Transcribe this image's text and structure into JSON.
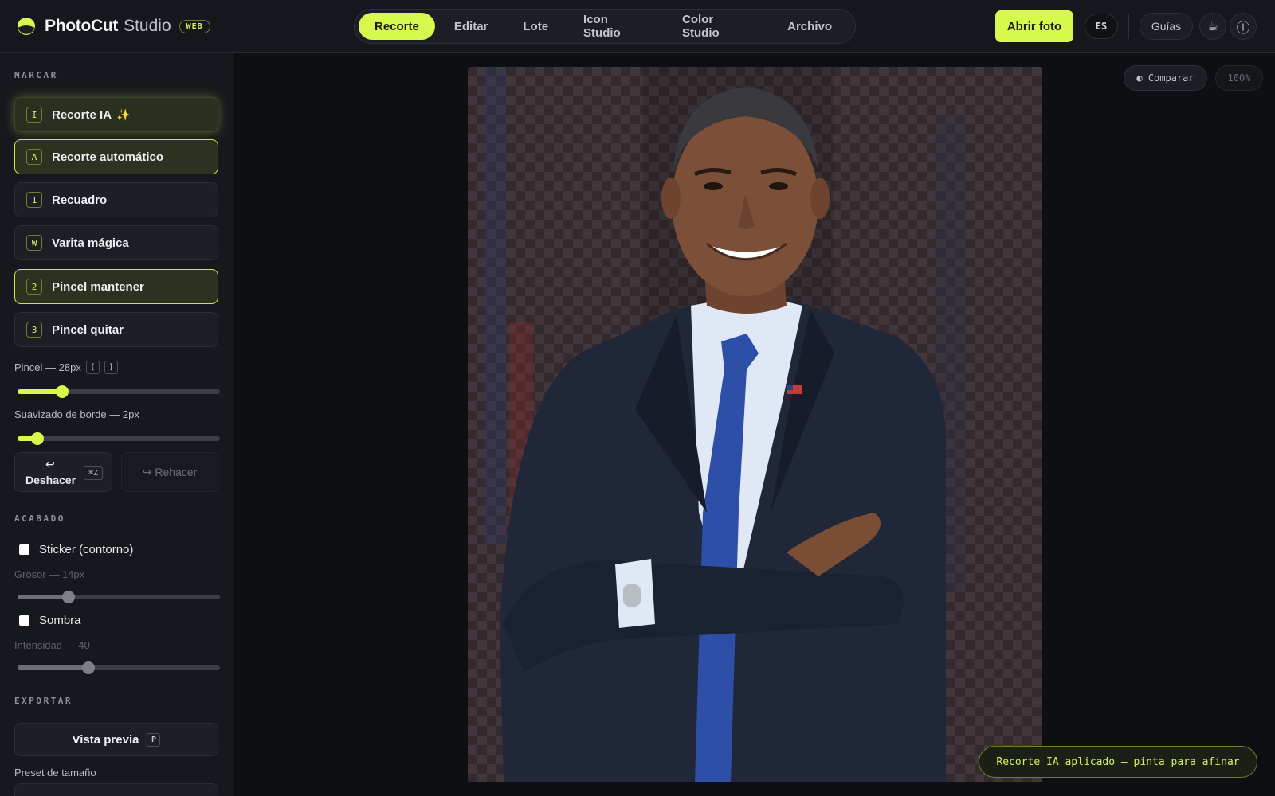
{
  "app": {
    "brand_name": "PhotoCut",
    "brand_sub": "Studio",
    "brand_badge": "WEB"
  },
  "tabs": [
    {
      "label": "Recorte",
      "active": true
    },
    {
      "label": "Editar",
      "active": false
    },
    {
      "label": "Lote",
      "active": false
    },
    {
      "label": "Icon Studio",
      "active": false
    },
    {
      "label": "Color Studio",
      "active": false
    },
    {
      "label": "Archivo",
      "active": false
    }
  ],
  "header": {
    "open_photo": "Abrir foto",
    "language": "ES",
    "guides": "Guías",
    "coffee_icon": "☕",
    "info_icon": "ⓘ"
  },
  "sidebar": {
    "mark_title": "MARCAR",
    "tools": [
      {
        "key": "I",
        "label": "Recorte IA",
        "sparkle": "✨"
      },
      {
        "key": "A",
        "label": "Recorte automático"
      },
      {
        "key": "1",
        "label": "Recuadro"
      },
      {
        "key": "W",
        "label": "Varita mágica"
      },
      {
        "key": "2",
        "label": "Pincel mantener"
      },
      {
        "key": "3",
        "label": "Pincel quitar"
      }
    ],
    "brush_label": "Pincel — 28px",
    "brush_key_left": "[",
    "brush_key_right": "]",
    "brush_level": 0.22,
    "feather_label": "Suavizado de borde — 2px",
    "feather_level": 0.1,
    "undo_icon": "↩",
    "undo_label": "Deshacer",
    "undo_shortcut": "⌘Z",
    "redo_label": "↪ Rehacer",
    "finish_title": "ACABADO",
    "sticker_label": "Sticker (contorno)",
    "thickness_label": "Grosor — 14px",
    "thickness_level": 0.25,
    "shadow_label": "Sombra",
    "intensity_label": "Intensidad — 40",
    "intensity_level": 0.35,
    "export_title": "EXPORTAR",
    "preview_label": "Vista previa",
    "preview_key": "P",
    "size_preset_label": "Preset de tamaño"
  },
  "canvas": {
    "compare_label": "◐ Comparar",
    "zoom": "100%",
    "toast": "Recorte IA aplicado — pinta para afinar"
  },
  "colors": {
    "accent": "#d7f84d",
    "background": "#121419",
    "panel": "#16181d"
  }
}
